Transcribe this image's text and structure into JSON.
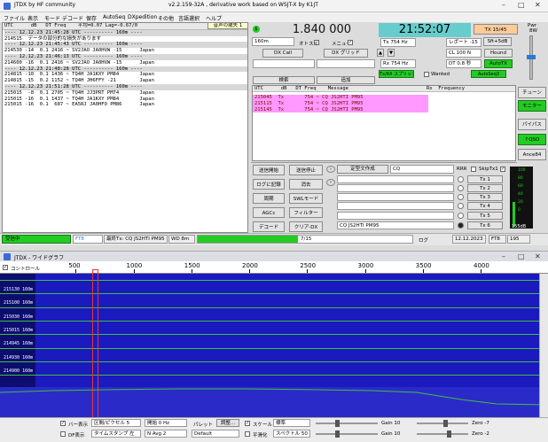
{
  "window": {
    "title": "JTDX by HF community",
    "subtitle": "v2.2.159-32A , derivative work based on WSJT-X by K1JT"
  },
  "menu": [
    "ファイル",
    "表示",
    "モード",
    "デコード",
    "保存",
    "AutoSeq",
    "DXpedition",
    "その他",
    "言語選択",
    "ヘルプ"
  ],
  "band_activity": {
    "header": "UTC      dB   DT Freq    平均=0.07 Lag=-0.67/0",
    "lines": [
      "---- 12.12.23 21:45:28 UTC ---------- 160m ----",
      "214515  データの部分的な損失があります",
      "---- 12.12.23 21:45:43 UTC ---------- 160m ----",
      "214530 -14  0.1 2416 ~ SV2JAO JA0HVW -15      Japan",
      "---- 12.12.23 21:46:13 UTC ---------- 160m ----",
      "214600 -16  0.1 2416 ~ SV2JAO JA0HVW -15      Japan",
      "---- 12.12.23 21:48:28 UTC ---------- 160m ----",
      "214815 -10  0.1 1436 ~ TQ4H JA1KXY PM84       Japan",
      "214815 -15  0.2 1152 ~ TQ4H JH6FFY -21        Japan",
      "---- 12.12.23 21:51:28 UTC ---------- 160m ----",
      "215015  -8  0.1 2705 ~ TQ4H JJ3PRT PM74       Japan",
      "215015 -16  0.1 1437 ~ TQ4H JA1KXY PM84       Japan",
      "215015 -16  0.1  687 ~ EA5RJ JA0HFO PM86      Japan"
    ]
  },
  "controls": {
    "band": "160m",
    "freq": "1.840 000",
    "clock": "21:52:07",
    "tx_badge": "TX 15/45",
    "sound_btn": "音声の歳失 1",
    "autoswitch": "オトスイ",
    "menu_chk": "メニュー",
    "tx_hz": "Tx  754  Hz",
    "report": "レポート  -15",
    "shift": "Sft+5dB",
    "rx_hz": "Rx  754  Hz",
    "cl": "CL  100  N",
    "hound": "Hound",
    "dt": "DT  0.8 秒",
    "autotx": "AutoTX",
    "txrx": "Tx/RX スプリット",
    "wanted": "Wanted",
    "autoseq": "AutoSeq3",
    "dxcall_btn": "DX Call",
    "dxgrid_btn": "DX グリッド",
    "search_btn": "検索",
    "add_btn": "追加",
    "pwr_label": "Pwr",
    "pwr_value": "8W"
  },
  "rx_freq": {
    "header": "UTC      dB   DT Freq    Message",
    "right_header": "Rx  Frequency",
    "lines": [
      "215045  Tx       754 ~ CQ JS2HTI PM95",
      "215115  Tx       754 ~ CQ JS2HTI PM95",
      "215145  Tx       754 ~ CQ JS2HTI PM95"
    ]
  },
  "side_buttons": [
    "チューン",
    "モニター",
    "パイパス",
    "↑QSO",
    "Ance84"
  ],
  "tx_panel": {
    "left": [
      "送信開始",
      "ログに記録",
      "周期",
      "AGCc",
      "デコード"
    ],
    "mid": [
      "送信停止",
      "消去",
      "SWLモード",
      "フィルター",
      "クリア-DX"
    ],
    "std_msg_btn": "定型文作成",
    "cq_field": "CQ",
    "rrr": "RRR",
    "skip_label": "SkipTx1",
    "tx_btns": [
      "Tx 1",
      "Tx 2",
      "Tx 3",
      "Tx 4",
      "Tx 5",
      "Tx 6"
    ],
    "tx6_msg": "CQ JS2HTI PM95"
  },
  "meter": {
    "ticks": [
      "100",
      "80",
      "60",
      "40",
      "20",
      "0"
    ],
    "db": "155dB"
  },
  "status": {
    "rx_state": "受信中",
    "mode": "FT8",
    "last_tx": "最終Tx: CQ JS2HTI PM95",
    "wd": "WD 8m",
    "progress": "7/15",
    "progress_frac": 0.466,
    "log": "ログ",
    "date": "12.12.2023",
    "mode2": "FT8",
    "count": "195"
  },
  "wide_graph": {
    "title": "JTDX - ワイドグラフ",
    "controlbar": "コントロール",
    "freq_ticks": [
      "500",
      "1000",
      "1500",
      "2000",
      "2500",
      "3000",
      "3500",
      "4000"
    ],
    "times": [
      "215130  160m",
      "215100  160m",
      "215030  160m",
      "215015  160m",
      "214945  160m",
      "214930  160m",
      "214900  160m"
    ],
    "bottom": {
      "bars": "バー表示",
      "bin_label": "区間/ピクセル  5",
      "start": "開始  0 Hz",
      "palette": "パレット",
      "adjust": "調整...",
      "scale": "スケール",
      "std": "標準",
      "gain1": "Gain  10",
      "zero1": "Zero  -7",
      "df": "DF表示",
      "timestamp": "タイムスタンプ 左",
      "navg": "N Avg 2",
      "default": "Default",
      "flatten": "平滑化",
      "spectral": "スペクトル  50",
      "gain2": "Gain  10",
      "zero2": "Zero  -2"
    }
  },
  "colors": {
    "accent_green": "#22cc22",
    "pink": "#ff99ff",
    "clock_bg": "#66cccc",
    "waterfall": "#1a1abf"
  }
}
